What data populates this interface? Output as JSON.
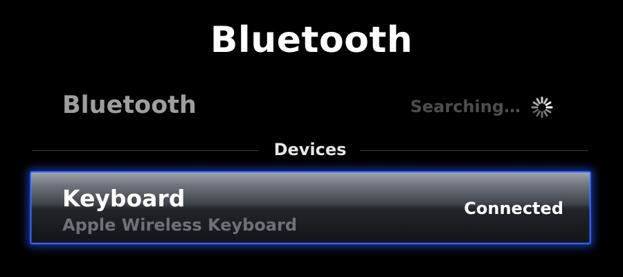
{
  "header": {
    "title": "Bluetooth"
  },
  "bluetooth_row": {
    "label": "Bluetooth",
    "status": "Searching…"
  },
  "devices_section": {
    "title": "Devices",
    "items": [
      {
        "name": "Keyboard",
        "model": "Apple Wireless Keyboard",
        "status": "Connected"
      }
    ]
  },
  "colors": {
    "selection_border": "#2a5dff",
    "background": "#000000",
    "dim_text": "#9e9e9e"
  },
  "icons": {
    "spinner": "activity-spinner-icon"
  }
}
